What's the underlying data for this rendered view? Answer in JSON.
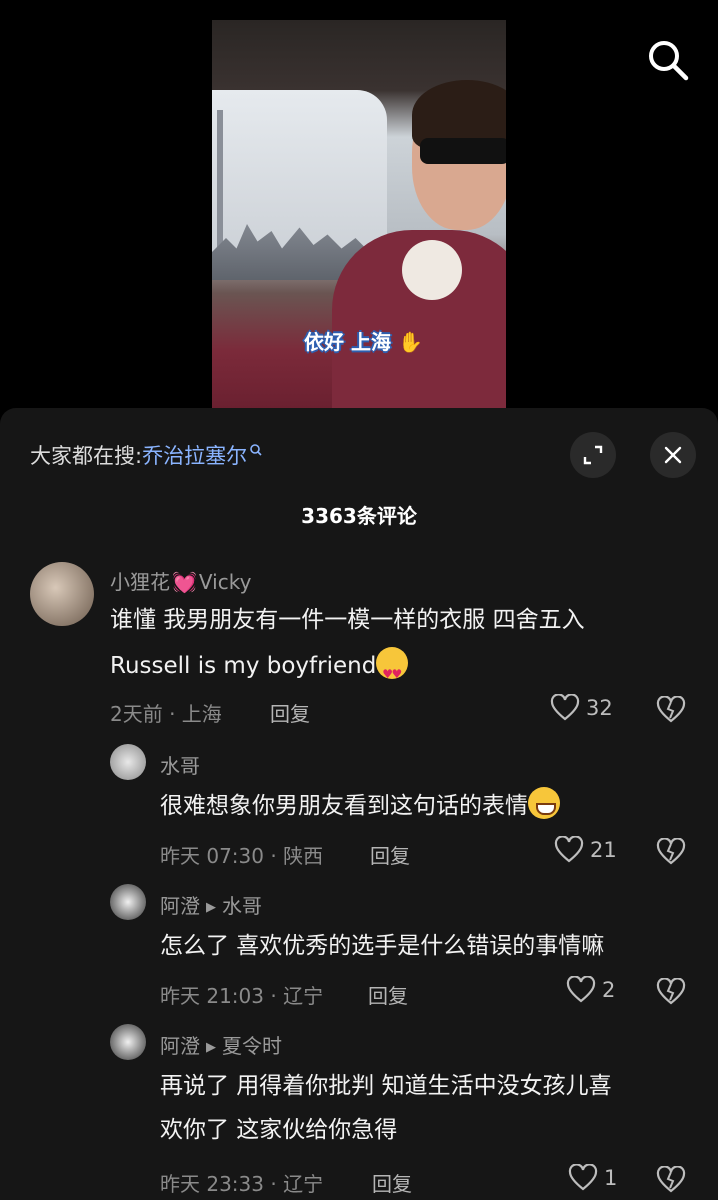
{
  "video": {
    "caption": "依好 上海"
  },
  "search_bar": {
    "prefix": "大家都在搜:",
    "term": "乔治拉塞尔"
  },
  "comment_count": "3363条评论",
  "comments": [
    {
      "username_a": "小狸花",
      "username_b": "Vicky",
      "line1": "谁懂 我男朋友有一件一模一样的衣服 四舍五入",
      "line2": "Russell is my boyfriend",
      "meta": "2天前 · 上海",
      "reply": "回复",
      "likes": "32"
    },
    {
      "username": "水哥",
      "line1": "很难想象你男朋友看到这句话的表情",
      "meta": "昨天 07:30 · 陕西",
      "reply": "回复",
      "likes": "21"
    },
    {
      "username": "阿澄",
      "reply_to": "水哥",
      "line1": "怎么了 喜欢优秀的选手是什么错误的事情嘛",
      "meta": "昨天 21:03 · 辽宁",
      "reply": "回复",
      "likes": "2"
    },
    {
      "username": "阿澄",
      "reply_to": "夏令时",
      "line1": "再说了 用得着你批判 知道生活中没女孩儿喜",
      "line2": "欢你了 这家伙给你急得",
      "meta": "昨天 23:33 · 辽宁",
      "reply": "回复",
      "likes": "1"
    }
  ]
}
